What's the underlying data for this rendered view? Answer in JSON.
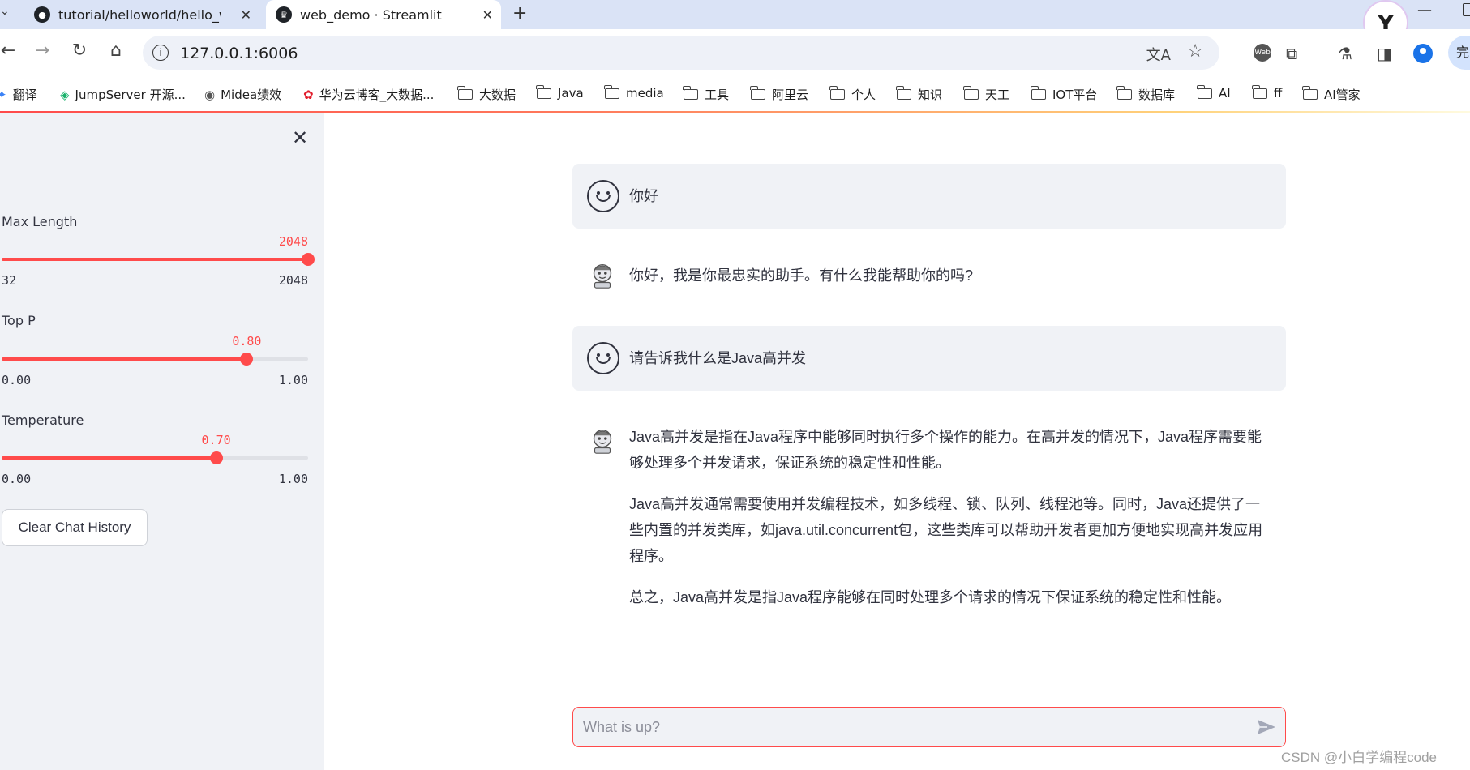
{
  "browser": {
    "tabs": [
      {
        "title": "tutorial/helloworld/hello_wo",
        "active": false,
        "favicon": "github-icon"
      },
      {
        "title": "web_demo · Streamlit",
        "active": true,
        "favicon": "streamlit-icon"
      }
    ],
    "new_tab_label": "+",
    "url": "127.0.0.1:6006",
    "complete_label": "完",
    "bookmarks": [
      {
        "label": "翻译",
        "icon": "translate-icon"
      },
      {
        "label": "JumpServer 开源...",
        "icon": "jumpserver-icon"
      },
      {
        "label": "Midea绩效",
        "icon": "globe-icon"
      },
      {
        "label": "华为云博客_大数据...",
        "icon": "huawei-icon"
      },
      {
        "label": "大数据",
        "icon": "folder-icon"
      },
      {
        "label": "Java",
        "icon": "folder-icon"
      },
      {
        "label": "media",
        "icon": "folder-icon"
      },
      {
        "label": "工具",
        "icon": "folder-icon"
      },
      {
        "label": "阿里云",
        "icon": "folder-icon"
      },
      {
        "label": "个人",
        "icon": "folder-icon"
      },
      {
        "label": "知识",
        "icon": "folder-icon"
      },
      {
        "label": "天工",
        "icon": "folder-icon"
      },
      {
        "label": "IOT平台",
        "icon": "folder-icon"
      },
      {
        "label": "数据库",
        "icon": "folder-icon"
      },
      {
        "label": "AI",
        "icon": "folder-icon"
      },
      {
        "label": "ff",
        "icon": "folder-icon"
      },
      {
        "label": "AI管家",
        "icon": "folder-icon"
      }
    ]
  },
  "sidebar": {
    "sliders": [
      {
        "label": "Max Length",
        "value": 2048,
        "value_label": "2048",
        "min": 32,
        "max": 2048,
        "min_label": "32",
        "max_label": "2048",
        "fraction": 1.0
      },
      {
        "label": "Top P",
        "value": 0.8,
        "value_label": "0.80",
        "min": 0,
        "max": 1,
        "min_label": "0.00",
        "max_label": "1.00",
        "fraction": 0.8
      },
      {
        "label": "Temperature",
        "value": 0.7,
        "value_label": "0.70",
        "min": 0,
        "max": 1,
        "min_label": "0.00",
        "max_label": "1.00",
        "fraction": 0.7
      }
    ],
    "clear_button": "Clear Chat History"
  },
  "chat": {
    "messages": [
      {
        "role": "user",
        "paragraphs": [
          "你好"
        ]
      },
      {
        "role": "assistant",
        "paragraphs": [
          "你好，我是你最忠实的助手。有什么我能帮助你的吗?"
        ]
      },
      {
        "role": "user",
        "paragraphs": [
          "请告诉我什么是Java高并发"
        ]
      },
      {
        "role": "assistant",
        "paragraphs": [
          "Java高并发是指在Java程序中能够同时执行多个操作的能力。在高并发的情况下，Java程序需要能够处理多个并发请求，保证系统的稳定性和性能。",
          "Java高并发通常需要使用并发编程技术，如多线程、锁、队列、线程池等。同时，Java还提供了一些内置的并发类库，如java.util.concurrent包，这些类库可以帮助开发者更加方便地实现高并发应用程序。",
          "总之，Java高并发是指Java程序能够在同时处理多个请求的情况下保证系统的稳定性和性能。"
        ]
      }
    ],
    "input_placeholder": "What is up?"
  },
  "colors": {
    "accent": "#ff4b4b",
    "sidebar_bg": "#f0f2f6",
    "tabbar_bg": "#dae3f6"
  },
  "watermark": "CSDN @小白学编程code"
}
